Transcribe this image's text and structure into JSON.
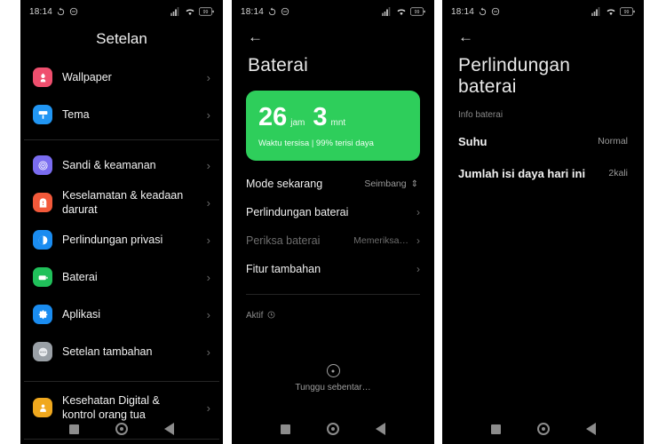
{
  "colors": {
    "background": "#000000",
    "page_gap": "#ffffff",
    "accent_green": "#2ece5b",
    "text_primary": "#f2f2f2",
    "text_secondary": "#9a9a9a",
    "text_disabled": "#6d6d6d"
  },
  "status_bar": {
    "time": "18:14",
    "left_icons": [
      "sync-icon",
      "dnd-icon"
    ],
    "right_icons": [
      "cellular-signal-icon",
      "wifi-icon",
      "battery-icon"
    ],
    "battery_level": "99"
  },
  "nav_bar": {
    "recents_label": "recents-square",
    "home_label": "home-circle",
    "back_label": "back-triangle"
  },
  "panel1": {
    "title": "Setelan",
    "groups": [
      {
        "items": [
          {
            "label": "Wallpaper",
            "icon": "wallpaper-icon",
            "icon_color": "#ef4f6e",
            "chevron": "›"
          },
          {
            "label": "Tema",
            "icon": "theme-icon",
            "icon_color": "#2196f3",
            "chevron": "›"
          }
        ]
      },
      {
        "items": [
          {
            "label": "Sandi & keamanan",
            "icon": "fingerprint-icon",
            "icon_color": "#7a6cf0",
            "chevron": "›"
          },
          {
            "label": "Keselamatan & keadaan darurat",
            "icon": "emergency-icon",
            "icon_color": "#f2593a",
            "chevron": "›"
          },
          {
            "label": "Perlindungan privasi",
            "icon": "privacy-icon",
            "icon_color": "#1a8cf0",
            "chevron": "›"
          },
          {
            "label": "Baterai",
            "icon": "battery-icon",
            "icon_color": "#20c05a",
            "chevron": "›"
          },
          {
            "label": "Aplikasi",
            "icon": "apps-gear-icon",
            "icon_color": "#1a8cf0",
            "chevron": "›"
          },
          {
            "label": "Setelan tambahan",
            "icon": "more-settings-icon",
            "icon_color": "#9aa0a6",
            "chevron": "›"
          }
        ]
      },
      {
        "items": [
          {
            "label": "Kesehatan Digital & kontrol orang tua",
            "icon": "digital-wellbeing-icon",
            "icon_color": "#f0a81e",
            "chevron": "›"
          }
        ]
      }
    ]
  },
  "panel2": {
    "back": "←",
    "title": "Baterai",
    "card": {
      "hours": "26",
      "hours_unit": "jam",
      "minutes": "3",
      "minutes_unit": "mnt",
      "subtitle": "Waktu tersisa | 99% terisi daya"
    },
    "rows": [
      {
        "label": "Mode sekarang",
        "value": "Seimbang",
        "control": "stepper",
        "disabled": false
      },
      {
        "label": "Perlindungan baterai",
        "value": "",
        "control": "chevron",
        "disabled": false
      },
      {
        "label": "Periksa baterai",
        "value": "Memeriksa…",
        "control": "chevron",
        "disabled": true
      },
      {
        "label": "Fitur tambahan",
        "value": "",
        "control": "chevron",
        "disabled": false
      }
    ],
    "active_label": "Aktif",
    "active_icon": "info-circle-icon",
    "loading_text": "Tunggu sebentar…"
  },
  "panel3": {
    "back": "←",
    "title": "Perlindungan baterai",
    "section_label": "Info baterai",
    "rows": [
      {
        "label": "Suhu",
        "value": "Normal"
      },
      {
        "label": "Jumlah isi daya hari ini",
        "value": "2kali"
      }
    ]
  }
}
